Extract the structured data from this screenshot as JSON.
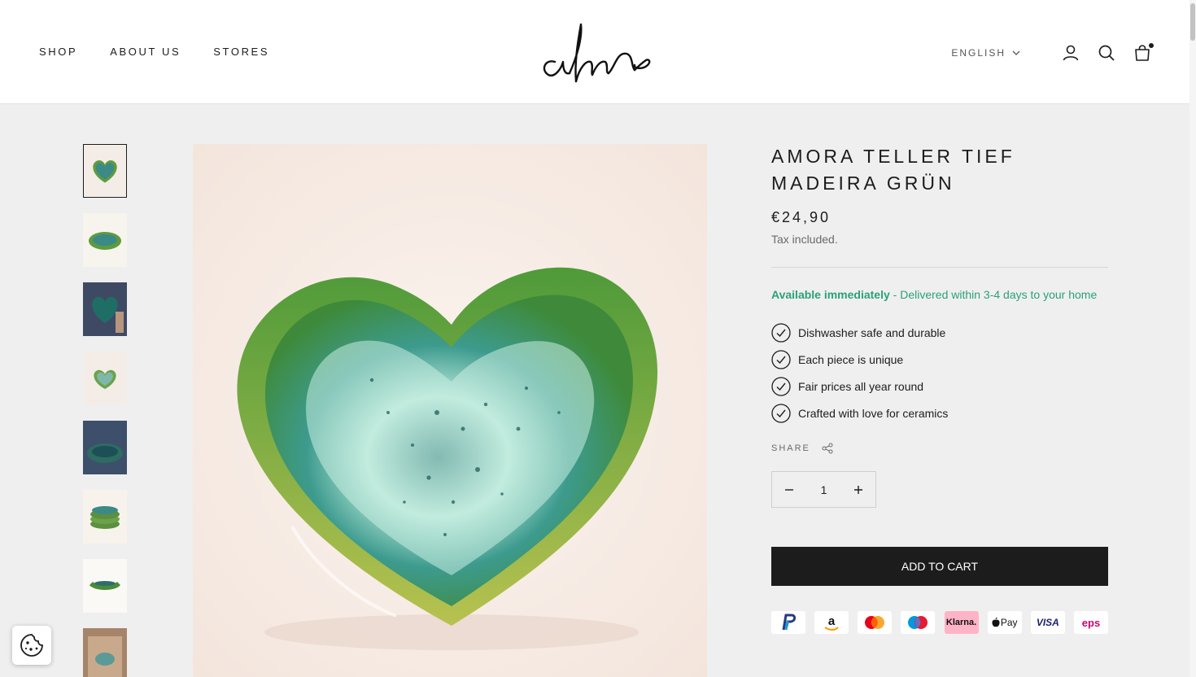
{
  "header": {
    "nav": [
      "SHOP",
      "ABOUT US",
      "STORES"
    ],
    "brand": "alma",
    "language": "ENGLISH",
    "icons": [
      "account-icon",
      "search-icon",
      "cart-icon"
    ]
  },
  "gallery": {
    "thumbnail_count": 8,
    "active_index": 0
  },
  "product": {
    "title": "AMORA TELLER TIEF MADEIRA GRÜN",
    "price": "€24,90",
    "tax_note": "Tax included.",
    "availability_strong": "Available immediately",
    "availability_rest": " - Delivered within 3-4 days to your home",
    "features": [
      "Dishwasher safe and durable",
      "Each piece is unique",
      "Fair prices all year round",
      "Crafted with love for ceramics"
    ],
    "share_label": "SHARE",
    "quantity": "1",
    "add_to_cart": "ADD TO CART",
    "payments": [
      "PayPal",
      "Amazon Pay",
      "Mastercard",
      "Maestro",
      "Klarna.",
      "Pay",
      "VISA",
      "eps"
    ]
  },
  "colors": {
    "accent_green": "#2aa17a",
    "button_dark": "#1c1c1c",
    "klarna_pink": "#ffb3c7"
  }
}
